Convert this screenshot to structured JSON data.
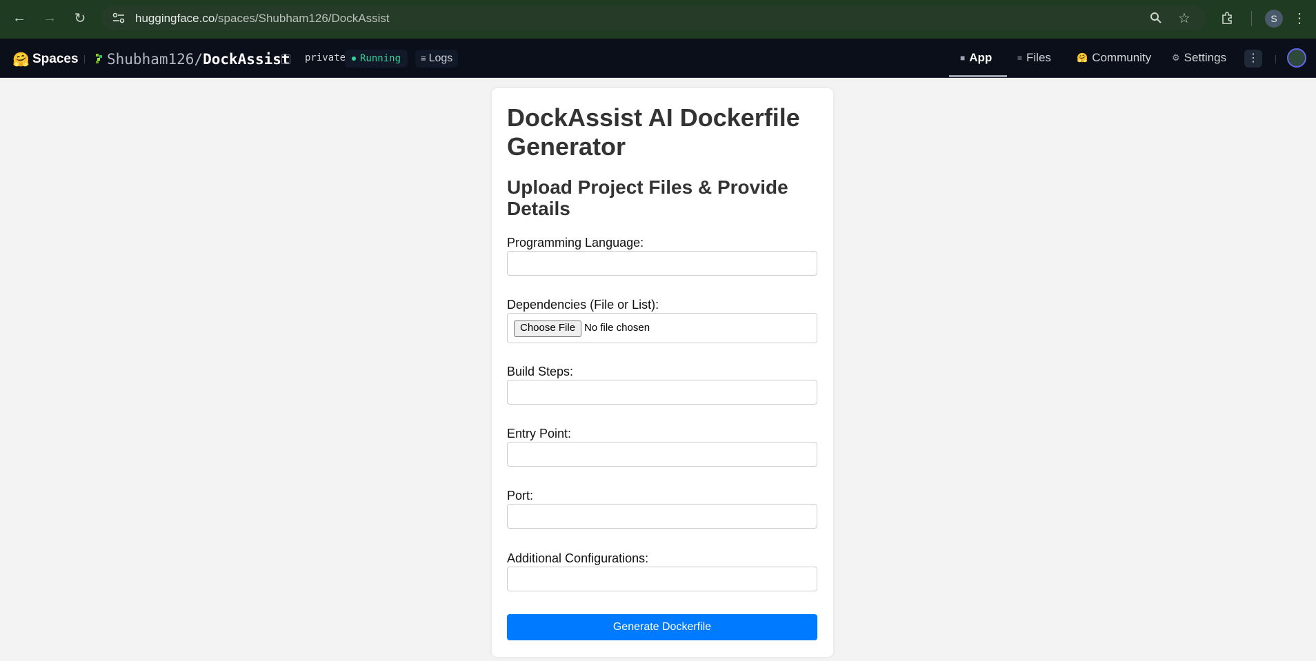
{
  "browser": {
    "url_host": "huggingface.co",
    "url_path": "/spaces/Shubham126/DockAssist",
    "profile_initial": "S"
  },
  "header": {
    "logo": "🤗",
    "spaces_label": "Spaces",
    "owner": "Shubham126",
    "repo": "DockAssist",
    "visibility": "private",
    "status": "Running",
    "logs_label": "Logs",
    "tabs": [
      {
        "label": "App",
        "icon": "cube-icon",
        "active": true
      },
      {
        "label": "Files",
        "icon": "files-icon"
      },
      {
        "label": "Community",
        "icon": "community-icon"
      },
      {
        "label": "Settings",
        "icon": "gear-icon"
      }
    ],
    "more_label": "⋮"
  },
  "form": {
    "title": "DockAssist AI Dockerfile Generator",
    "subtitle": "Upload Project Files & Provide Details",
    "language_label": "Programming Language:",
    "dependencies_label": "Dependencies (File or List):",
    "choose_file_label": "Choose File",
    "no_file_label": "No file chosen",
    "build_steps_label": "Build Steps:",
    "entry_point_label": "Entry Point:",
    "port_label": "Port:",
    "additional_label": "Additional Configurations:",
    "submit_label": "Generate Dockerfile"
  },
  "colors": {
    "primary": "#007bff",
    "running": "#34d399",
    "header_bg": "#0b0f19"
  }
}
